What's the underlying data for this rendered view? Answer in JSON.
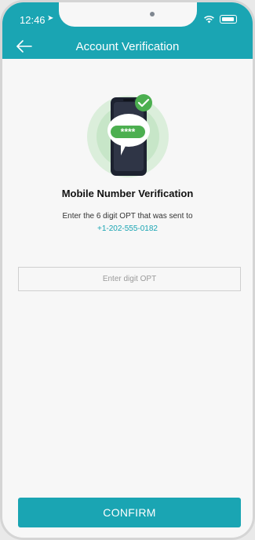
{
  "status_bar": {
    "time": "12:46",
    "icons": [
      "location-arrow-icon",
      "wifi-icon",
      "battery-icon"
    ]
  },
  "header": {
    "title": "Account Verification",
    "back_icon": "arrow-left-icon"
  },
  "illustration": {
    "code_mask": "****",
    "icon": "phone-otp-check-icon"
  },
  "main": {
    "heading": "Mobile Number  Verification",
    "instruction": "Enter the 6 digit OPT that was sent to",
    "phone_number": "+1-202-555-0182",
    "otp_placeholder": "Enter digit OPT",
    "otp_value": ""
  },
  "footer": {
    "confirm_label": "CONFIRM"
  },
  "colors": {
    "accent": "#1aa5b3",
    "success": "#4caf50",
    "background": "#f7f7f7"
  }
}
